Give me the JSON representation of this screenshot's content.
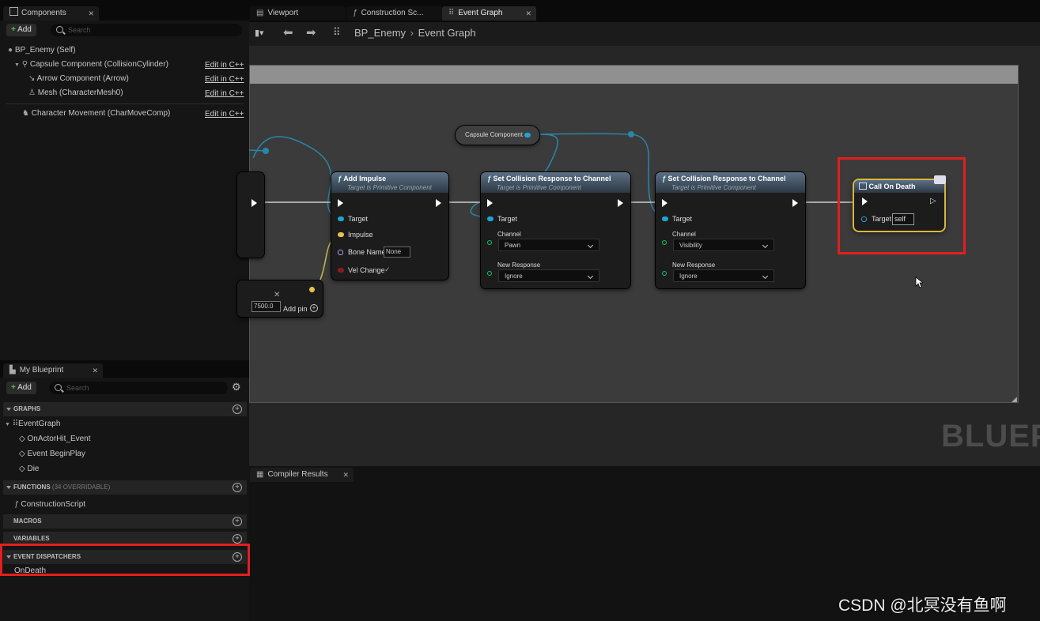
{
  "components_panel": {
    "tab_label": "Components",
    "add_label": "Add",
    "search_placeholder": "Search",
    "items": [
      {
        "label": "BP_Enemy (Self)"
      },
      {
        "label": "Capsule Component (CollisionCylinder)",
        "edit": "Edit in C++"
      },
      {
        "label": "Arrow Component (Arrow)",
        "edit": "Edit in C++"
      },
      {
        "label": "Mesh (CharacterMesh0)",
        "edit": "Edit in C++"
      },
      {
        "label": "Character Movement (CharMoveComp)",
        "edit": "Edit in C++"
      }
    ]
  },
  "editor_tabs": [
    {
      "label": "Viewport"
    },
    {
      "label": "Construction Sc..."
    },
    {
      "label": "Event Graph"
    }
  ],
  "breadcrumb": {
    "blueprint": "BP_Enemy",
    "graph": "Event Graph"
  },
  "graph": {
    "watermark": "BLUEP",
    "capsule_node_label": "Capsule Component",
    "add_impulse": {
      "title": "Add Impulse",
      "subtitle": "Target is Primitive Component",
      "pins": {
        "target": "Target",
        "impulse": "Impulse",
        "bone_name": "Bone Name",
        "bone_value": "None",
        "vel_change": "Vel Change"
      }
    },
    "set_collision_1": {
      "title": "Set Collision Response to Channel",
      "subtitle": "Target is Primitive Component",
      "target": "Target",
      "channel_label": "Channel",
      "channel_value": "Pawn",
      "response_label": "New Response",
      "response_value": "Ignore"
    },
    "set_collision_2": {
      "title": "Set Collision Response to Channel",
      "subtitle": "Target is Primitive Component",
      "target": "Target",
      "channel_label": "Channel",
      "channel_value": "Visibility",
      "response_label": "New Response",
      "response_value": "Ignore"
    },
    "call_on_death": {
      "title": "Call On Death",
      "target": "Target",
      "target_value": "self"
    },
    "make_vector": {
      "value": "7500.0",
      "add_pin": "Add pin"
    }
  },
  "my_blueprint": {
    "tab_label": "My Blueprint",
    "add_label": "Add",
    "search_placeholder": "Search",
    "graphs_header": "GRAPHS",
    "graph_items": [
      "EventGraph",
      "OnActorHit_Event",
      "Event BeginPlay",
      "Die"
    ],
    "functions_header": "FUNCTIONS",
    "functions_sub": "(34 OVERRIDABLE)",
    "function_items": [
      "ConstructionScript"
    ],
    "macros_header": "MACROS",
    "variables_header": "VARIABLES",
    "dispatchers_header": "EVENT DISPATCHERS",
    "dispatcher_items": [
      "OnDeath"
    ]
  },
  "compiler_results": {
    "tab_label": "Compiler Results"
  },
  "credit": "CSDN @北冥没有鱼啊",
  "colors": {
    "highlight": "#e0201e",
    "exec": "#ffffff",
    "object_pin": "#1fa3d4",
    "struct_pin": "#e5c547",
    "name_pin": "#b49cf0",
    "bool_pin": "#8c1a1a"
  }
}
